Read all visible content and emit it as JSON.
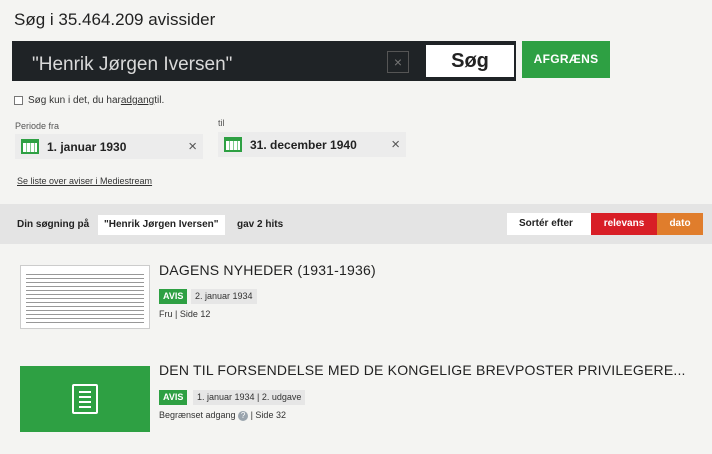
{
  "header": {
    "title": "Søg i 35.464.209 avissider"
  },
  "search": {
    "query": "\"Henrik Jørgen Iversen\"",
    "clear_symbol": "×",
    "search_label": "Søg",
    "refine_label": "AFGRÆNS"
  },
  "access_filter": {
    "text_before": "Søg kun i det, du har ",
    "link_text": "adgang",
    "text_after": " til."
  },
  "period": {
    "from_label": "Periode fra",
    "from_value": "1. januar 1930",
    "to_label": "til",
    "to_value": "31. december 1940",
    "clear_symbol": "×"
  },
  "links": {
    "newspaper_list": "Se liste over aviser i Mediestream"
  },
  "results_bar": {
    "prefix": "Din søgning på",
    "query": "\"Henrik Jørgen Iversen\"",
    "suffix": "gav 2 hits",
    "sort_label": "Sortér efter",
    "sort_relevance": "relevans",
    "sort_date": "dato"
  },
  "results": [
    {
      "title": "DAGENS NYHEDER (1931-1936)",
      "badge": "AVIS",
      "meta": "2. januar 1934",
      "sub": "Fru | Side 12"
    },
    {
      "title": "DEN TIL FORSENDELSE MED DE KONGELIGE BREVPOSTER PRIVILEGERE...",
      "badge": "AVIS",
      "meta": "1. januar 1934 | 2. udgave",
      "sub_before": "Begrænset adgang",
      "help_symbol": "?",
      "sub_after": "| Side 32"
    }
  ],
  "colors": {
    "green": "#2ea043",
    "relevance_red": "#d81e26",
    "date_orange": "#e07d2c",
    "search_dark": "#1f2326"
  }
}
